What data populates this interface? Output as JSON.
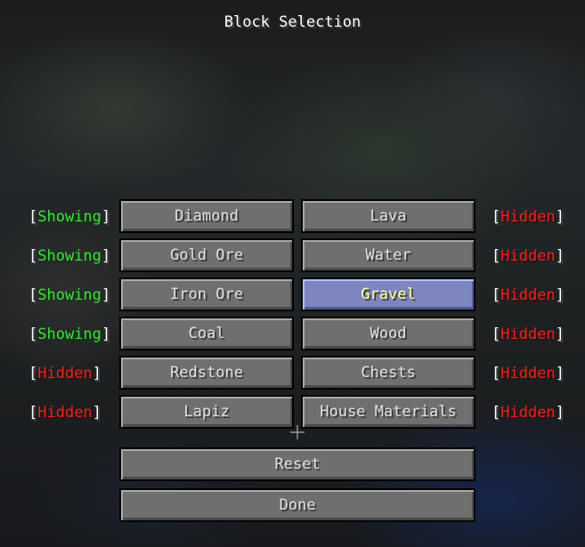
{
  "screen": {
    "title": "Block Selection"
  },
  "blocks": {
    "left": [
      {
        "name": "Diamond",
        "status": "Showing"
      },
      {
        "name": "Gold Ore",
        "status": "Showing"
      },
      {
        "name": "Iron Ore",
        "status": "Showing"
      },
      {
        "name": "Coal",
        "status": "Showing"
      },
      {
        "name": "Redstone",
        "status": "Hidden"
      },
      {
        "name": "Lapiz",
        "status": "Hidden"
      }
    ],
    "right": [
      {
        "name": "Lava",
        "status": "Hidden"
      },
      {
        "name": "Water",
        "status": "Hidden"
      },
      {
        "name": "Gravel",
        "status": "Hidden",
        "hovered": true
      },
      {
        "name": "Wood",
        "status": "Hidden"
      },
      {
        "name": "Chests",
        "status": "Hidden"
      },
      {
        "name": "House Materials",
        "status": "Hidden"
      }
    ]
  },
  "status_brackets": {
    "open": "[",
    "close": "]"
  },
  "actions": {
    "reset_label": "Reset",
    "done_label": "Done"
  },
  "colors": {
    "showing": "#3ee03e",
    "hidden": "#e82222",
    "button": "#6f6f6f",
    "button_hover": "#7e86c0",
    "hover_text": "#ffffa0"
  }
}
